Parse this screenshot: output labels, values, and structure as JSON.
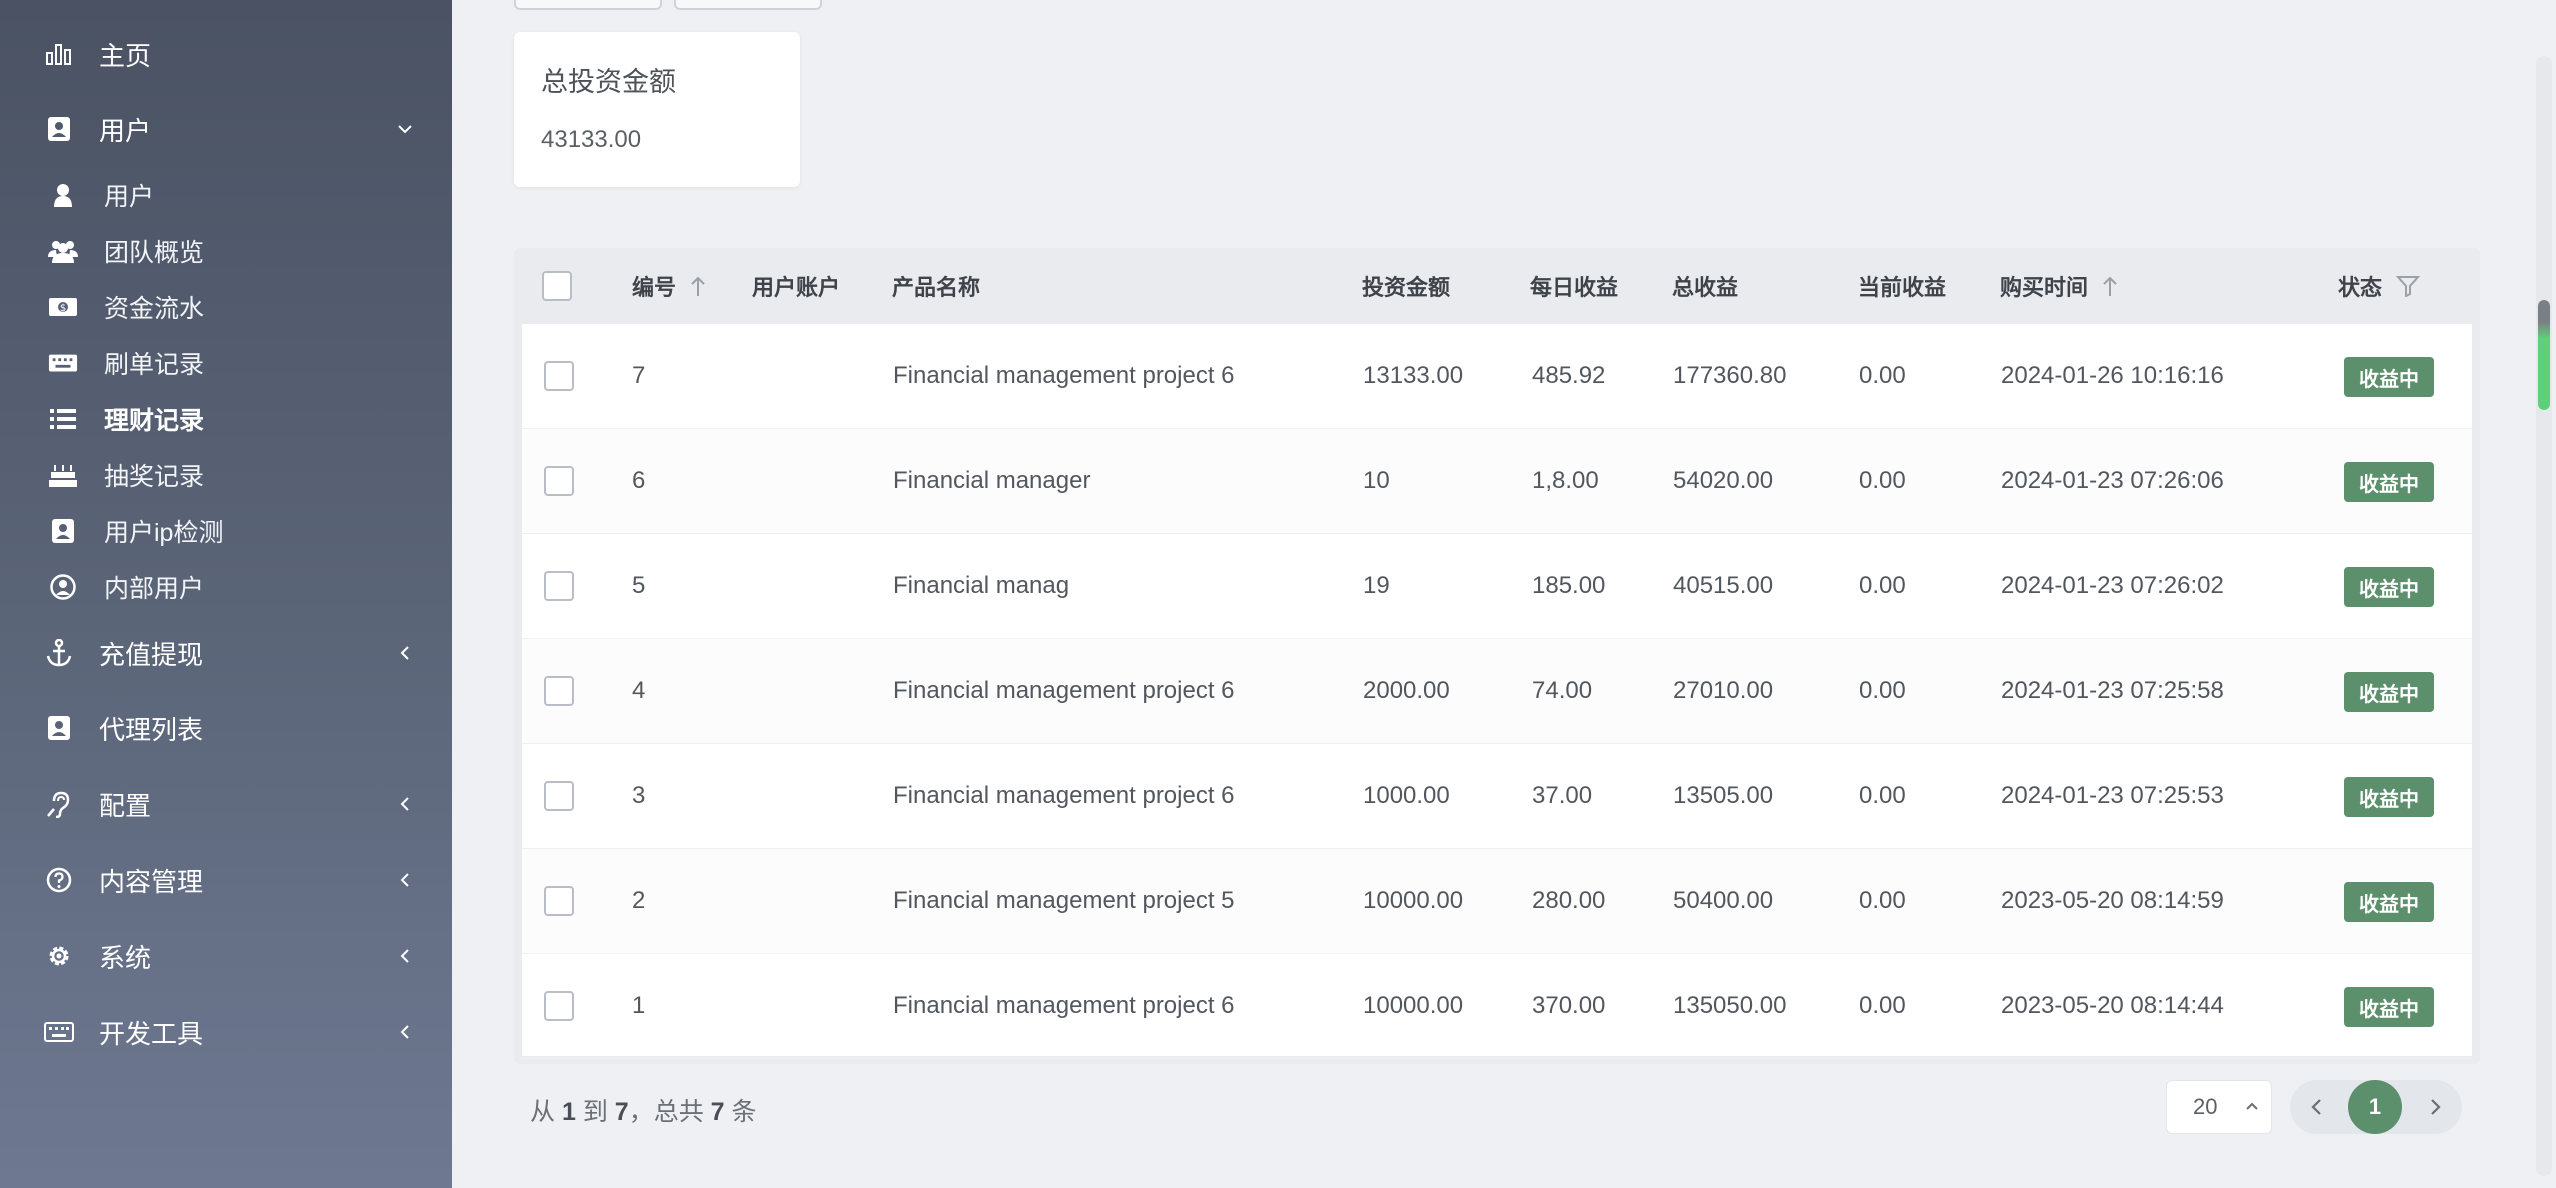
{
  "sidebar": {
    "home": "主页",
    "users_group": "用户",
    "sub_items": [
      "用户",
      "团队概览",
      "资金流水",
      "刷单记录",
      "理财记录",
      "抽奖记录",
      "用户ip检测",
      "内部用户"
    ],
    "recharge": "充值提现",
    "agents": "代理列表",
    "config": "配置",
    "content": "内容管理",
    "system": "系统",
    "devtools": "开发工具"
  },
  "summary": {
    "title": "总投资金额",
    "value": "43133.00"
  },
  "table": {
    "headers": {
      "id": "编号",
      "account": "用户账户",
      "product": "产品名称",
      "amount": "投资金额",
      "daily": "每日收益",
      "total": "总收益",
      "current": "当前收益",
      "time": "购买时间",
      "status": "状态"
    },
    "rows": [
      {
        "id": "7",
        "account": "",
        "product": "Financial management project 6",
        "amount": "13133.00",
        "daily": "485.92",
        "total": "177360.80",
        "current": "0.00",
        "time": "2024-01-26 10:16:16",
        "status": "收益中"
      },
      {
        "id": "6",
        "account": "",
        "product": "Financial manager",
        "amount": "10",
        "daily": "1,8.00",
        "total": "54020.00",
        "current": "0.00",
        "time": "2024-01-23 07:26:06",
        "status": "收益中"
      },
      {
        "id": "5",
        "account": "",
        "product": "Financial manag",
        "amount": "19",
        "daily": "185.00",
        "total": "40515.00",
        "current": "0.00",
        "time": "2024-01-23 07:26:02",
        "status": "收益中"
      },
      {
        "id": "4",
        "account": "",
        "product": "Financial management project 6",
        "amount": "2000.00",
        "daily": "74.00",
        "total": "27010.00",
        "current": "0.00",
        "time": "2024-01-23 07:25:58",
        "status": "收益中"
      },
      {
        "id": "3",
        "account": "",
        "product": "Financial management project 6",
        "amount": "1000.00",
        "daily": "37.00",
        "total": "13505.00",
        "current": "0.00",
        "time": "2024-01-23 07:25:53",
        "status": "收益中"
      },
      {
        "id": "2",
        "account": "",
        "product": "Financial management project 5",
        "amount": "10000.00",
        "daily": "280.00",
        "total": "50400.00",
        "current": "0.00",
        "time": "2023-05-20 08:14:59",
        "status": "收益中"
      },
      {
        "id": "1",
        "account": "",
        "product": "Financial management project 6",
        "amount": "10000.00",
        "daily": "370.00",
        "total": "135050.00",
        "current": "0.00",
        "time": "2023-05-20 08:14:44",
        "status": "收益中"
      }
    ]
  },
  "footer": {
    "from_label": "从",
    "from": "1",
    "to_label": "到",
    "to": "7",
    "total_label": "，总共",
    "total": "7",
    "unit": "条"
  },
  "pagination": {
    "page_size": "20",
    "current_page": "1"
  },
  "colors": {
    "accent": "#5c8f6c",
    "sidebar_top": "#4a5263",
    "sidebar_bottom": "#6e7891"
  }
}
